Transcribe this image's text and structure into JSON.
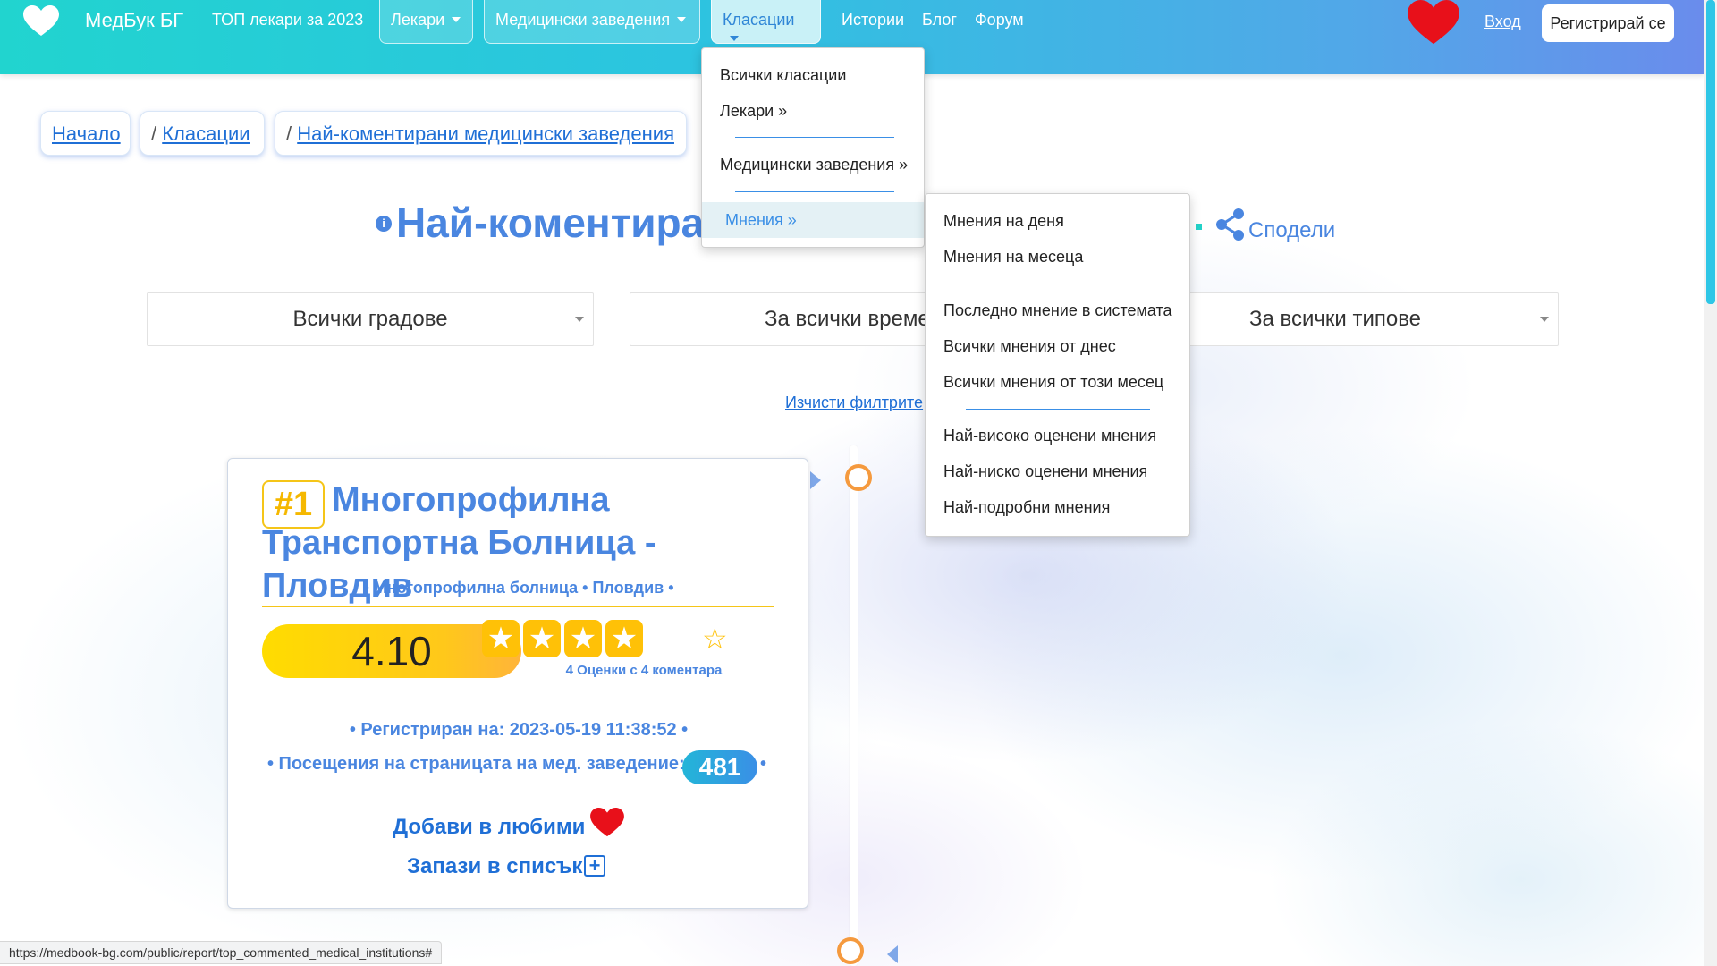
{
  "brand": {
    "name": "МедБук БГ"
  },
  "nav": {
    "top_doctors": "ТОП лекари за 2023",
    "doctors": "Лекари",
    "institutions": "Медицински заведения",
    "rankings": "Класации",
    "stories": "Истории",
    "blog": "Блог",
    "forum": "Форум",
    "login": "Вход",
    "register": "Регистрирай се"
  },
  "breadcrumb": [
    {
      "label": "Начало",
      "prefix": ""
    },
    {
      "label": "Класации",
      "prefix": "/ "
    },
    {
      "label": "Най-коментирани медицински заведения",
      "prefix": "/ "
    }
  ],
  "page": {
    "title": "Най-коментиран",
    "share": "Сподели"
  },
  "filters": {
    "city": "Всички градове",
    "period": "За всички времен",
    "type": "За всички типове",
    "clear": "Изчисти филтрите"
  },
  "card": {
    "rank": "#1",
    "title": "Многопрофилна Транспортна Болница - Пловдив",
    "subtitle": "• Многопрофилна болница • Пловдив •",
    "score": "4.10",
    "stars_filled": 4,
    "stars_total": 5,
    "ratings_count": "4 Оценки с 4 коментара",
    "registered": "• Регистриран на: 2023-05-19 11:38:52 •",
    "visits_label": "• Посещения на страницата на мед. заведение:",
    "visits": "481",
    "visits_suffix": "•",
    "add_favorite": "Добави в любими",
    "save_list": "Запази в списък"
  },
  "rankings_menu": {
    "items": [
      "Всички класации",
      "Лекари »",
      "Медицински заведения »",
      "Мнения »"
    ]
  },
  "opinions_menu": {
    "items": [
      "Мнения на деня",
      "Мнения на месеца",
      "Последно мнение в системата",
      "Всички мнения от днес",
      "Всички мнения от този месец",
      "Най-високо оценени мнения",
      "Най-ниско оценени мнения",
      "Най-подробни мнения"
    ]
  },
  "status_bar": {
    "url": "https://medbook-bg.com/public/report/top_commented_medical_institutions#"
  },
  "colors": {
    "accent": "#4a86e0",
    "link": "#1f6fd6",
    "gold": "#ffc107",
    "heart": "#e8101a",
    "timeline_dot": "#f59a3e"
  },
  "icons": [
    "heart-icon",
    "caret-down-icon",
    "info-icon",
    "share-icon",
    "star-icon",
    "plus-square-icon"
  ]
}
